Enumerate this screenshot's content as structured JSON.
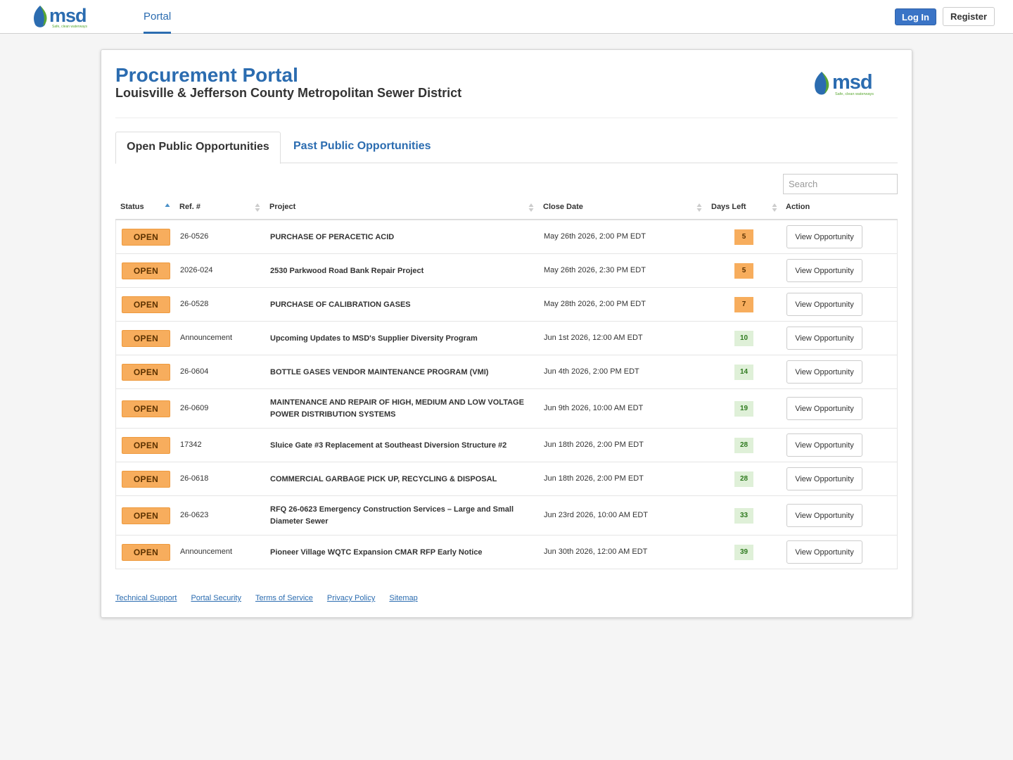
{
  "nav": {
    "logo_text": "msd",
    "logo_tagline": "Safe, clean waterways",
    "portal_label": "Portal",
    "login_label": "Log In",
    "register_label": "Register"
  },
  "header": {
    "title": "Procurement Portal",
    "subtitle": "Louisville & Jefferson County Metropolitan Sewer District"
  },
  "tabs": {
    "open_label": "Open Public Opportunities",
    "past_label": "Past Public Opportunities"
  },
  "search": {
    "placeholder": "Search"
  },
  "table": {
    "headers": {
      "status": "Status",
      "ref": "Ref. #",
      "project": "Project",
      "close_date": "Close Date",
      "days_left": "Days Left",
      "action": "Action"
    },
    "rows": [
      {
        "status": "OPEN",
        "ref": "26-0526",
        "project": "PURCHASE OF PERACETIC ACID",
        "close": "May 26th 2026, 2:00 PM EDT",
        "days": "5",
        "level": "warn",
        "action": "View Opportunity"
      },
      {
        "status": "OPEN",
        "ref": "2026-024",
        "project": "2530 Parkwood Road Bank Repair Project",
        "close": "May 26th 2026, 2:30 PM EDT",
        "days": "5",
        "level": "warn",
        "action": "View Opportunity"
      },
      {
        "status": "OPEN",
        "ref": "26-0528",
        "project": "PURCHASE OF CALIBRATION GASES",
        "close": "May 28th 2026, 2:00 PM EDT",
        "days": "7",
        "level": "warn",
        "action": "View Opportunity"
      },
      {
        "status": "OPEN",
        "ref": "Announcement",
        "project": "Upcoming Updates to MSD's Supplier Diversity Program",
        "close": "Jun 1st 2026, 12:00 AM EDT",
        "days": "10",
        "level": "ok",
        "action": "View Opportunity"
      },
      {
        "status": "OPEN",
        "ref": "26-0604",
        "project": "BOTTLE GASES VENDOR MAINTENANCE PROGRAM (VMI)",
        "close": "Jun 4th 2026, 2:00 PM EDT",
        "days": "14",
        "level": "ok",
        "action": "View Opportunity"
      },
      {
        "status": "OPEN",
        "ref": "26-0609",
        "project": "MAINTENANCE AND REPAIR OF HIGH, MEDIUM AND LOW VOLTAGE POWER DISTRIBUTION SYSTEMS",
        "close": "Jun 9th 2026, 10:00 AM EDT",
        "days": "19",
        "level": "ok",
        "action": "View Opportunity",
        "tall": true
      },
      {
        "status": "OPEN",
        "ref": "17342",
        "project": "Sluice Gate #3 Replacement at Southeast Diversion Structure #2",
        "close": "Jun 18th 2026, 2:00 PM EDT",
        "days": "28",
        "level": "ok",
        "action": "View Opportunity"
      },
      {
        "status": "OPEN",
        "ref": "26-0618",
        "project": "COMMERCIAL GARBAGE PICK UP, RECYCLING & DISPOSAL",
        "close": "Jun 18th 2026, 2:00 PM EDT",
        "days": "28",
        "level": "ok",
        "action": "View Opportunity"
      },
      {
        "status": "OPEN",
        "ref": "26-0623",
        "project": "RFQ 26-0623 Emergency Construction Services – Large and Small Diameter Sewer",
        "close": "Jun 23rd 2026, 10:00 AM EDT",
        "days": "33",
        "level": "ok",
        "action": "View Opportunity",
        "tall": true
      },
      {
        "status": "OPEN",
        "ref": "Announcement",
        "project": "Pioneer Village WQTC Expansion CMAR RFP Early Notice",
        "close": "Jun 30th 2026, 12:00 AM EDT",
        "days": "39",
        "level": "ok",
        "action": "View Opportunity"
      }
    ]
  },
  "footer": {
    "links": [
      "Technical Support",
      "Portal Security",
      "Terms of Service",
      "Privacy Policy",
      "Sitemap"
    ]
  },
  "colors": {
    "brand_blue": "#2b6cb0",
    "logo_green": "#5aa832",
    "open_orange": "#f7ad5d",
    "days_green_bg": "#dff0d8"
  }
}
